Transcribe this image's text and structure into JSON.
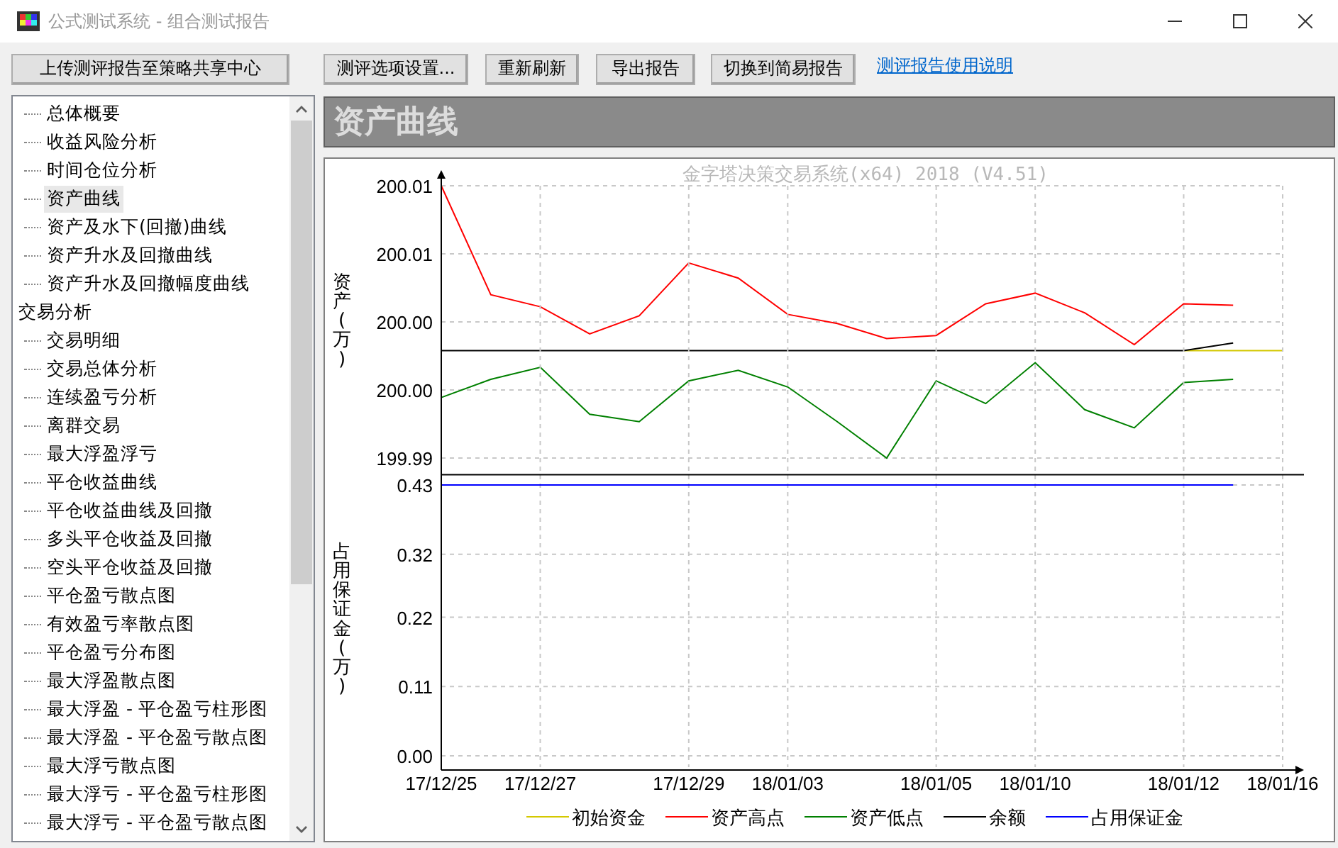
{
  "window": {
    "title": "公式测试系统 - 组合测试报告",
    "active": false
  },
  "toolbar": {
    "buttons": [
      "上传测评报告至策略共享中心",
      "测评选项设置...",
      "重新刷新",
      "导出报告",
      "切换到简易报告"
    ],
    "link": "测评报告使用说明"
  },
  "tree": {
    "items": [
      {
        "children": [
          {
            "label": "总体概要",
            "selected": false
          },
          {
            "label": "收益风险分析",
            "selected": false
          },
          {
            "label": "时间仓位分析",
            "selected": false
          },
          {
            "label": "资产曲线",
            "selected": true
          },
          {
            "label": "资产及水下(回撤)曲线",
            "selected": false
          },
          {
            "label": "资产升水及回撤曲线",
            "selected": false
          },
          {
            "label": "资产升水及回撤幅度曲线",
            "selected": false
          }
        ]
      },
      {
        "label": "交易分析",
        "selected": false,
        "children": [
          {
            "label": "交易明细",
            "selected": false
          },
          {
            "label": "交易总体分析",
            "selected": false
          },
          {
            "label": "连续盈亏分析",
            "selected": false
          },
          {
            "label": "离群交易",
            "selected": false
          },
          {
            "label": "最大浮盈浮亏",
            "selected": false
          },
          {
            "label": "平仓收益曲线",
            "selected": false
          },
          {
            "label": "平仓收益曲线及回撤",
            "selected": false
          },
          {
            "label": "多头平仓收益及回撤",
            "selected": false
          },
          {
            "label": "空头平仓收益及回撤",
            "selected": false
          },
          {
            "label": "平仓盈亏散点图",
            "selected": false
          },
          {
            "label": "有效盈亏率散点图",
            "selected": false
          },
          {
            "label": "平仓盈亏分布图",
            "selected": false
          },
          {
            "label": "最大浮盈散点图",
            "selected": false
          },
          {
            "label": "最大浮盈 - 平仓盈亏柱形图",
            "selected": false
          },
          {
            "label": "最大浮盈 - 平仓盈亏散点图",
            "selected": false
          },
          {
            "label": "最大浮亏散点图",
            "selected": false
          },
          {
            "label": "最大浮亏 - 平仓盈亏柱形图",
            "selected": false
          },
          {
            "label": "最大浮亏 - 平仓盈亏散点图",
            "selected": false
          }
        ]
      }
    ]
  },
  "section": {
    "title": "资产曲线"
  },
  "charts": [
    {
      "chart_data": {
        "type": "line",
        "title": "金字塔决策交易系统(x64) 2018 (V4.51)",
        "ylabel": "资产(万)",
        "ylim": [
          199.993,
          200.011
        ],
        "grid": true,
        "yticks": [
          {
            "value": 199.993,
            "label": "199.99"
          },
          {
            "value": 199.9975,
            "label": "200.00"
          },
          {
            "value": 200.002,
            "label": "200.00"
          },
          {
            "value": 200.0065,
            "label": "200.01"
          },
          {
            "value": 200.011,
            "label": "200.01"
          }
        ],
        "series": [
          {
            "name": "初始资金",
            "color": "#d4c800",
            "values": [
              null,
              null,
              null,
              null,
              null,
              null,
              null,
              null,
              null,
              null,
              null,
              null,
              null,
              null,
              null,
              200.0001,
              200.0001,
              200.0001
            ]
          },
          {
            "name": "资产高点",
            "color": "#ff0000",
            "values": [
              200.011,
              200.0038,
              200.003,
              200.0012,
              200.0024,
              200.0059,
              200.0049,
              200.0025,
              200.0019,
              200.0009,
              200.0011,
              200.0032,
              200.0039,
              200.0026,
              200.0005,
              200.0032,
              200.0031,
              null
            ]
          },
          {
            "name": "资产低点",
            "color": "#008000",
            "values": [
              199.997,
              199.9982,
              199.999,
              199.9959,
              199.9954,
              199.9981,
              199.9988,
              199.9977,
              199.9954,
              199.993,
              199.9981,
              199.9966,
              199.9993,
              199.9962,
              199.995,
              199.998,
              199.9982,
              null
            ]
          },
          {
            "name": "余额",
            "color": "#000000",
            "values": [
              200.0001,
              200.0001,
              200.0001,
              200.0001,
              200.0001,
              200.0001,
              200.0001,
              200.0001,
              200.0001,
              200.0001,
              200.0001,
              200.0001,
              200.0001,
              200.0001,
              200.0001,
              200.0001,
              200.0006,
              null
            ]
          }
        ]
      }
    },
    {
      "chart_data": {
        "type": "line",
        "ylabel": "占用保证金(万)",
        "categories": [
          "17/12/25",
          null,
          "17/12/27",
          null,
          null,
          "17/12/29",
          null,
          "18/01/03",
          null,
          null,
          "18/01/05",
          null,
          "18/01/10",
          null,
          null,
          "18/01/12",
          null,
          "18/01/16"
        ],
        "ylim": [
          0,
          0.43
        ],
        "grid": true,
        "yticks": [
          {
            "value": 0,
            "label": "0.00"
          },
          {
            "value": 0.11,
            "label": "0.11"
          },
          {
            "value": 0.22,
            "label": "0.22"
          },
          {
            "value": 0.32,
            "label": "0.32"
          },
          {
            "value": 0.43,
            "label": "0.43"
          }
        ],
        "series": [
          {
            "name": "占用保证金",
            "color": "#0000ff",
            "values": [
              0.43,
              0.43,
              0.43,
              0.43,
              0.43,
              0.43,
              0.43,
              0.43,
              0.43,
              0.43,
              0.43,
              0.43,
              0.43,
              0.43,
              0.43,
              0.43,
              0.43,
              null
            ]
          }
        ]
      }
    }
  ]
}
